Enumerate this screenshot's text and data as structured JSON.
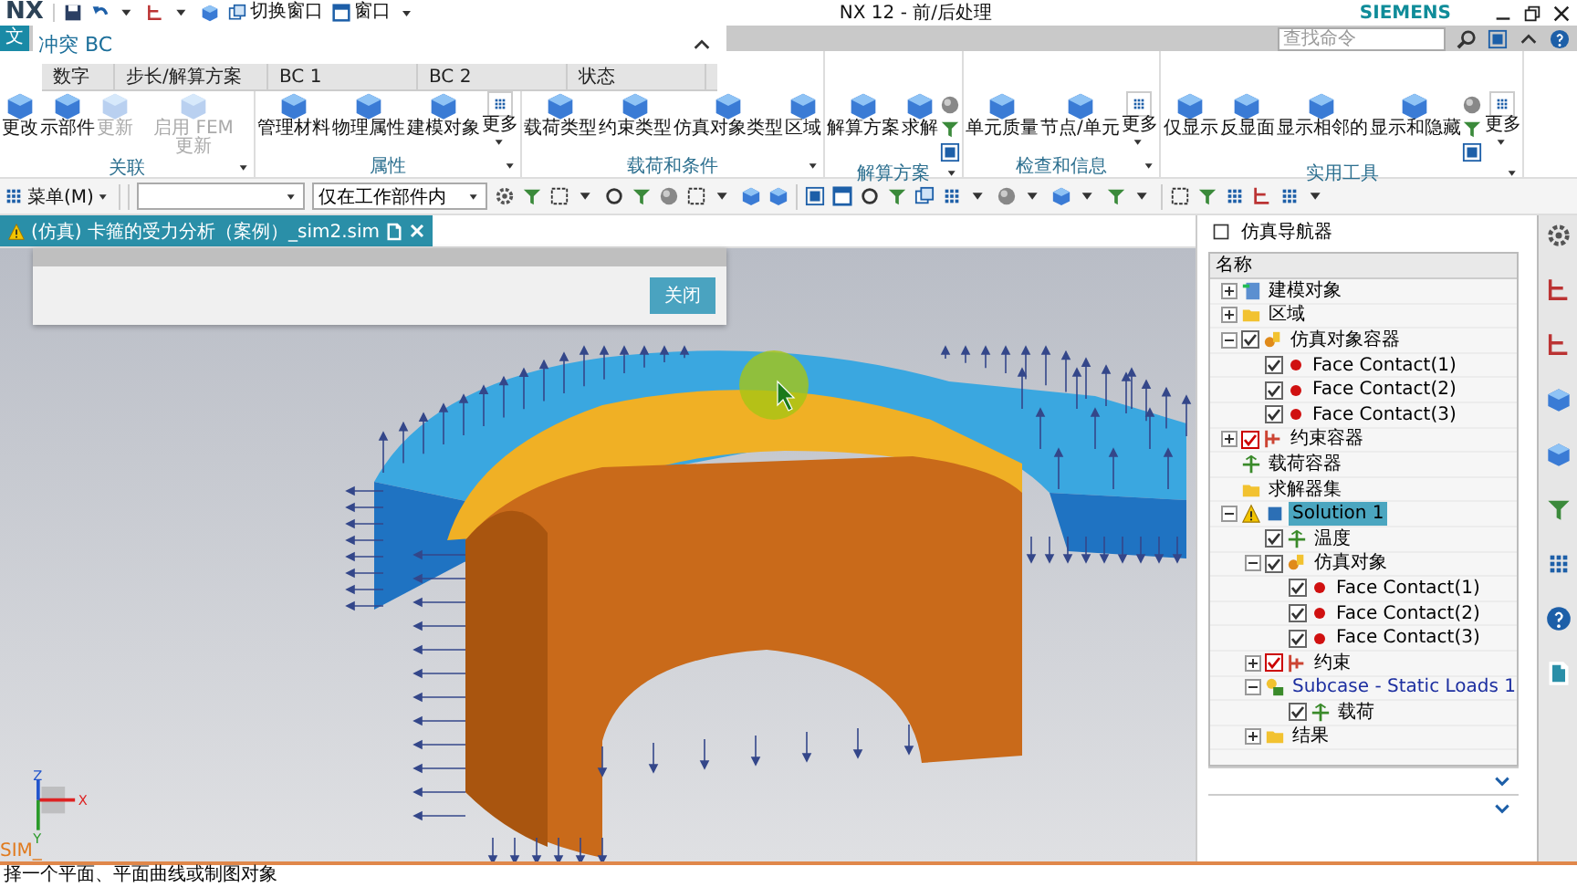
{
  "title_bar": {
    "app": "NX",
    "switch_window": "切换窗口",
    "window_menu": "窗口",
    "title": "NX 12 - 前/后处理",
    "brand": "SIEMENS"
  },
  "ribbon": {
    "file_tab": "文",
    "search": {
      "placeholder": "查找命令"
    },
    "groups": [
      {
        "label": "关联",
        "items": [
          {
            "label": "更改",
            "kind": "large",
            "disabled": false
          },
          {
            "label": "示部件",
            "kind": "large",
            "disabled": false
          },
          {
            "label": "更新",
            "kind": "large",
            "disabled": true
          },
          {
            "label": "启用 FEM 更新",
            "kind": "large",
            "disabled": true
          }
        ]
      },
      {
        "label": "属性",
        "items": [
          {
            "label": "管理材料",
            "kind": "large",
            "disabled": false
          },
          {
            "label": "物理属性",
            "kind": "large",
            "disabled": false
          },
          {
            "label": "建模对象",
            "kind": "large",
            "disabled": false
          },
          {
            "label": "更多",
            "kind": "more",
            "disabled": false
          }
        ]
      },
      {
        "label": "载荷和条件",
        "items": [
          {
            "label": "载荷类型",
            "kind": "large",
            "disabled": false
          },
          {
            "label": "约束类型",
            "kind": "large",
            "disabled": false
          },
          {
            "label": "仿真对象类型",
            "kind": "large",
            "disabled": false
          },
          {
            "label": "区域",
            "kind": "large",
            "disabled": false
          }
        ]
      },
      {
        "label": "解算方案",
        "items": [
          {
            "label": "解算方案",
            "kind": "large",
            "disabled": false
          },
          {
            "label": "求解",
            "kind": "large",
            "disabled": false
          },
          {
            "kind": "stack"
          }
        ]
      },
      {
        "label": "检查和信息",
        "items": [
          {
            "label": "单元质量",
            "kind": "large",
            "disabled": false
          },
          {
            "label": "节点/单元",
            "kind": "large",
            "disabled": false
          },
          {
            "label": "更多",
            "kind": "more",
            "disabled": false
          }
        ]
      },
      {
        "label": "实用工具",
        "items": [
          {
            "label": "仅显示",
            "kind": "large",
            "disabled": false
          },
          {
            "label": "反显面",
            "kind": "large",
            "disabled": false
          },
          {
            "label": "显示相邻的",
            "kind": "large",
            "disabled": false
          },
          {
            "label": "显示和隐藏",
            "kind": "large",
            "disabled": false
          },
          {
            "kind": "stack"
          },
          {
            "label": "更多",
            "kind": "more",
            "disabled": false
          }
        ]
      }
    ]
  },
  "toolbar": {
    "menu": "菜单(M)",
    "scope": {
      "value": "仅在工作部件内"
    }
  },
  "doc_tabs": [
    {
      "label": "(仿真) 卡箍的受力分析（案例）_sim2.sim",
      "selected": true
    }
  ],
  "dialog": {
    "title": "冲突 BC",
    "columns": [
      "数字",
      "步长/解算方案",
      "BC 1",
      "BC 2",
      "状态"
    ],
    "close_button": "关闭"
  },
  "viewport": {
    "axes": [
      "X",
      "Y",
      "Z"
    ],
    "view_label": "SIM_"
  },
  "navigator": {
    "title": "仿真导航器",
    "column": "名称",
    "tree": [
      {
        "label": "建模对象",
        "kind": "model",
        "expanded": false,
        "selected": false
      },
      {
        "label": "区域",
        "kind": "folder",
        "expanded": false,
        "selected": false
      },
      {
        "label": "仿真对象容器",
        "kind": "simobj",
        "checked": true,
        "expanded": true,
        "selected": false,
        "children": [
          {
            "label": "Face Contact(1)",
            "kind": "contact",
            "checked": true,
            "selected": false
          },
          {
            "label": "Face Contact(2)",
            "kind": "contact",
            "checked": true,
            "selected": false
          },
          {
            "label": "Face Contact(3)",
            "kind": "contact",
            "checked": true,
            "selected": false
          }
        ]
      },
      {
        "label": "约束容器",
        "kind": "constraint",
        "checked": true,
        "expanded": false,
        "selected": false
      },
      {
        "label": "载荷容器",
        "kind": "load",
        "selected": false
      },
      {
        "label": "求解器集",
        "kind": "folder",
        "selected": false
      },
      {
        "label": "Solution 1",
        "kind": "solution",
        "expanded": true,
        "selected": true,
        "children": [
          {
            "label": "温度",
            "kind": "load",
            "checked": true,
            "selected": false
          },
          {
            "label": "仿真对象",
            "kind": "simobj",
            "checked": true,
            "expanded": true,
            "selected": false,
            "children": [
              {
                "label": "Face Contact(1)",
                "kind": "contact",
                "checked": true,
                "selected": false
              },
              {
                "label": "Face Contact(2)",
                "kind": "contact",
                "checked": true,
                "selected": false
              },
              {
                "label": "Face Contact(3)",
                "kind": "contact",
                "checked": true,
                "selected": false
              }
            ]
          },
          {
            "label": "约束",
            "kind": "constraint",
            "checked": true,
            "expanded": false,
            "selected": false
          },
          {
            "label": "Subcase - Static Loads 1",
            "kind": "subcase",
            "expanded": true,
            "selected": false,
            "children": [
              {
                "label": "载荷",
                "kind": "load",
                "checked": true,
                "selected": false
              }
            ]
          },
          {
            "label": "结果",
            "kind": "folder",
            "expanded": false,
            "selected": false
          }
        ]
      }
    ]
  },
  "status_bar": {
    "prompt": "择一个平面、平面曲线或制图对象"
  }
}
